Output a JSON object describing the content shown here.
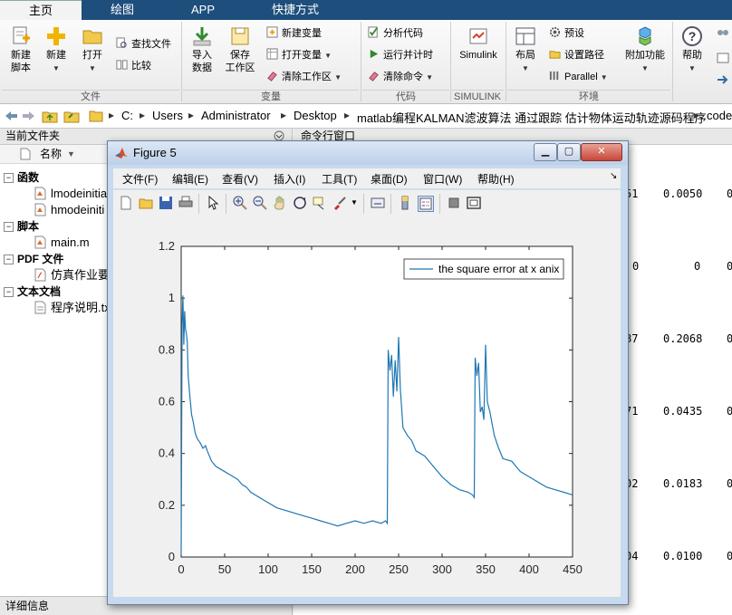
{
  "tabs": [
    "主页",
    "绘图",
    "APP",
    "快捷方式"
  ],
  "ribbon": {
    "new_script": [
      "新建",
      "脚本"
    ],
    "new": "新建",
    "open": "打开",
    "find_files": "查找文件",
    "compare": "比较",
    "import_data": [
      "导入",
      "数据"
    ],
    "save_workspace": [
      "保存",
      "工作区"
    ],
    "new_variable": "新建变量",
    "open_variable": "打开变量",
    "clear_workspace": "清除工作区",
    "analyze_code": "分析代码",
    "run_and_time": "运行并计时",
    "clear_commands": "清除命令",
    "simulink": "Simulink",
    "layout": "布局",
    "preferences": "预设",
    "set_path": "设置路径",
    "parallel": "Parallel",
    "addons": "附加功能",
    "help": "帮助",
    "groups": [
      "文件",
      "变量",
      "代码",
      "SIMULINK",
      "环境"
    ]
  },
  "address": {
    "crumbs": [
      "C:",
      "Users",
      "Administrator",
      "Desktop",
      "matlab编程KALMAN滤波算法 通过跟踪 估计物体运动轨迹源码程序",
      "code"
    ]
  },
  "current_folder": {
    "title": "当前文件夹",
    "column": "名称",
    "groups": [
      {
        "label": "函数",
        "items": [
          "lmodeinitia",
          "hmodeiniti"
        ]
      },
      {
        "label": "脚本",
        "items": [
          "main.m"
        ]
      },
      {
        "label": "PDF 文件",
        "items": [
          "仿真作业要"
        ]
      },
      {
        "label": "文本文档",
        "items": [
          "程序说明.tx"
        ]
      }
    ],
    "details": "详细信息"
  },
  "command_window": {
    "title": "命令行窗口",
    "rows": [
      {
        "a": "51",
        "b": "0.0050",
        "c": "0"
      },
      {
        "a": "0",
        "b": "0",
        "c": "0"
      },
      {
        "a": "87",
        "b": "0.2068",
        "c": "0"
      },
      {
        "a": "71",
        "b": "0.0435",
        "c": "0"
      },
      {
        "a": "02",
        "b": "0.0183",
        "c": "0"
      },
      {
        "a": "04",
        "b": "0.0100",
        "c": "0"
      }
    ]
  },
  "figure": {
    "title": "Figure 5",
    "menus": [
      "文件(F)",
      "编辑(E)",
      "查看(V)",
      "插入(I)",
      "工具(T)",
      "桌面(D)",
      "窗口(W)",
      "帮助(H)"
    ]
  },
  "colors": {
    "line": "#1f77b4",
    "tabbar": "#1e4e7c"
  },
  "chart_data": {
    "type": "line",
    "legend": "the square error at x anix",
    "legend_position": "top-right",
    "xlim": [
      0,
      450
    ],
    "ylim": [
      0,
      1.2
    ],
    "xticks": [
      0,
      50,
      100,
      150,
      200,
      250,
      300,
      350,
      400,
      450
    ],
    "yticks": [
      0,
      0.2,
      0.4,
      0.6,
      0.8,
      1,
      1.2
    ],
    "grid": false,
    "x": [
      0,
      1,
      2,
      3,
      4,
      5,
      6,
      7,
      8,
      10,
      12,
      14,
      16,
      18,
      20,
      22,
      25,
      28,
      30,
      35,
      40,
      45,
      50,
      55,
      60,
      65,
      70,
      75,
      80,
      85,
      90,
      95,
      100,
      110,
      120,
      130,
      140,
      150,
      160,
      170,
      180,
      190,
      200,
      210,
      220,
      230,
      235,
      237,
      238,
      240,
      242,
      244,
      246,
      248,
      250,
      252,
      255,
      260,
      265,
      270,
      280,
      290,
      300,
      310,
      320,
      330,
      335,
      337,
      338,
      340,
      342,
      344,
      346,
      348,
      350,
      352,
      355,
      360,
      365,
      370,
      380,
      390,
      400,
      410,
      420,
      430,
      440,
      450
    ],
    "y": [
      0.01,
      0.9,
      1.01,
      0.82,
      0.95,
      0.88,
      0.86,
      0.83,
      0.7,
      0.62,
      0.55,
      0.52,
      0.48,
      0.46,
      0.45,
      0.44,
      0.42,
      0.43,
      0.41,
      0.37,
      0.35,
      0.34,
      0.33,
      0.32,
      0.31,
      0.3,
      0.28,
      0.27,
      0.25,
      0.24,
      0.23,
      0.22,
      0.21,
      0.19,
      0.18,
      0.17,
      0.16,
      0.15,
      0.14,
      0.13,
      0.12,
      0.13,
      0.14,
      0.13,
      0.14,
      0.13,
      0.14,
      0.13,
      0.8,
      0.72,
      0.78,
      0.62,
      0.76,
      0.64,
      0.85,
      0.65,
      0.5,
      0.47,
      0.45,
      0.41,
      0.39,
      0.35,
      0.31,
      0.28,
      0.26,
      0.25,
      0.24,
      0.23,
      0.77,
      0.7,
      0.75,
      0.56,
      0.58,
      0.53,
      0.82,
      0.6,
      0.56,
      0.47,
      0.42,
      0.38,
      0.37,
      0.33,
      0.31,
      0.29,
      0.27,
      0.26,
      0.25,
      0.24
    ]
  }
}
